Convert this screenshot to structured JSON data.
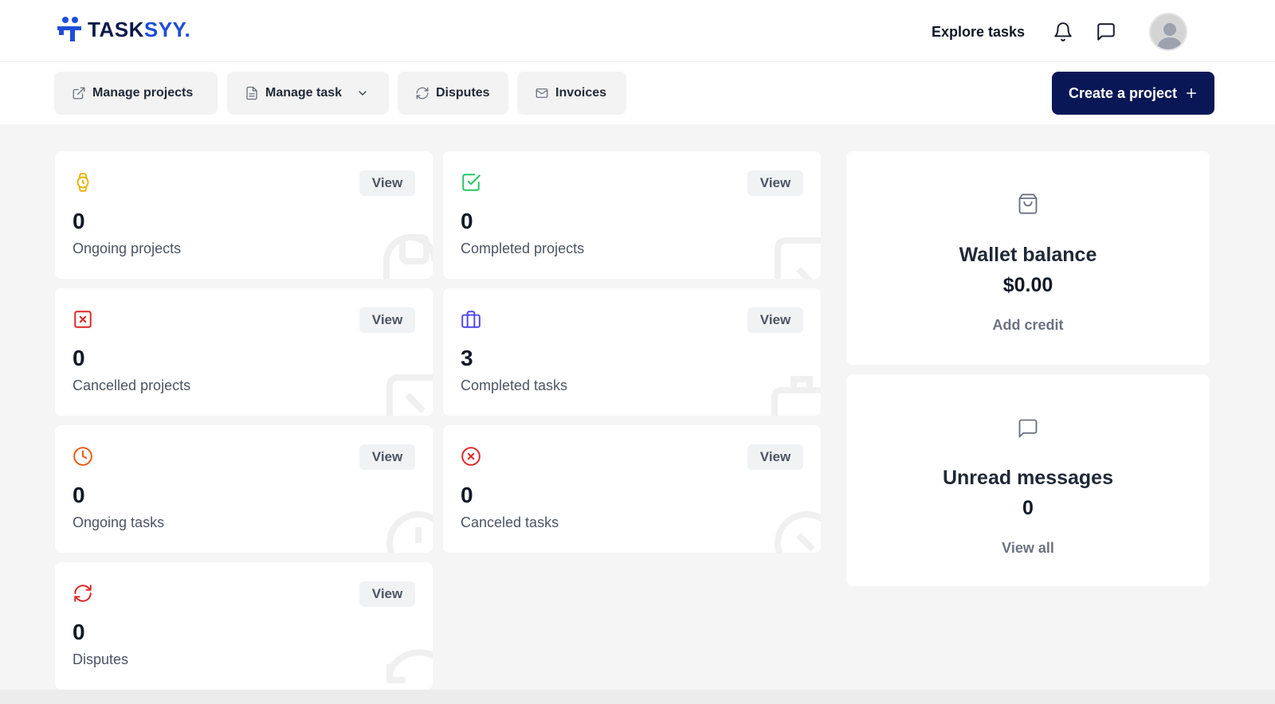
{
  "brand": {
    "name_dark": "TASK",
    "name_blue": "SYY."
  },
  "header": {
    "explore_label": "Explore tasks"
  },
  "toolbar": {
    "tabs": [
      {
        "label": "Manage projects",
        "icon": "external-link-icon"
      },
      {
        "label": "Manage task",
        "icon": "document-icon",
        "has_dropdown": true
      },
      {
        "label": "Disputes",
        "icon": "refresh-icon"
      },
      {
        "label": "Invoices",
        "icon": "mail-icon"
      }
    ],
    "create_label": "Create a project",
    "create_icon": "plus-icon"
  },
  "stats": {
    "view_label": "View",
    "cards": [
      {
        "count": "0",
        "label": "Ongoing projects",
        "icon": "watch-icon",
        "color": "#eab308"
      },
      {
        "count": "0",
        "label": "Completed projects",
        "icon": "check-square-icon",
        "color": "#22c55e"
      },
      {
        "count": "0",
        "label": "Cancelled projects",
        "icon": "x-square-icon",
        "color": "#dc2626"
      },
      {
        "count": "3",
        "label": "Completed tasks",
        "icon": "briefcase-icon",
        "color": "#4f46e5"
      },
      {
        "count": "0",
        "label": "Ongoing tasks",
        "icon": "clock-icon",
        "color": "#ea580c"
      },
      {
        "count": "0",
        "label": "Canceled tasks",
        "icon": "x-circle-icon",
        "color": "#dc2626"
      },
      {
        "count": "0",
        "label": "Disputes",
        "icon": "refresh-icon",
        "color": "#dc2626"
      }
    ]
  },
  "wallet": {
    "title": "Wallet balance",
    "amount": "$0.00",
    "action_label": "Add credit",
    "icon": "shopping-bag-icon"
  },
  "messages": {
    "title": "Unread messages",
    "count": "0",
    "action_label": "View all",
    "icon": "message-square-icon"
  },
  "colors": {
    "primary": "#0a1757",
    "brand_blue": "#1e4ed8",
    "background": "#f5f5f5"
  }
}
